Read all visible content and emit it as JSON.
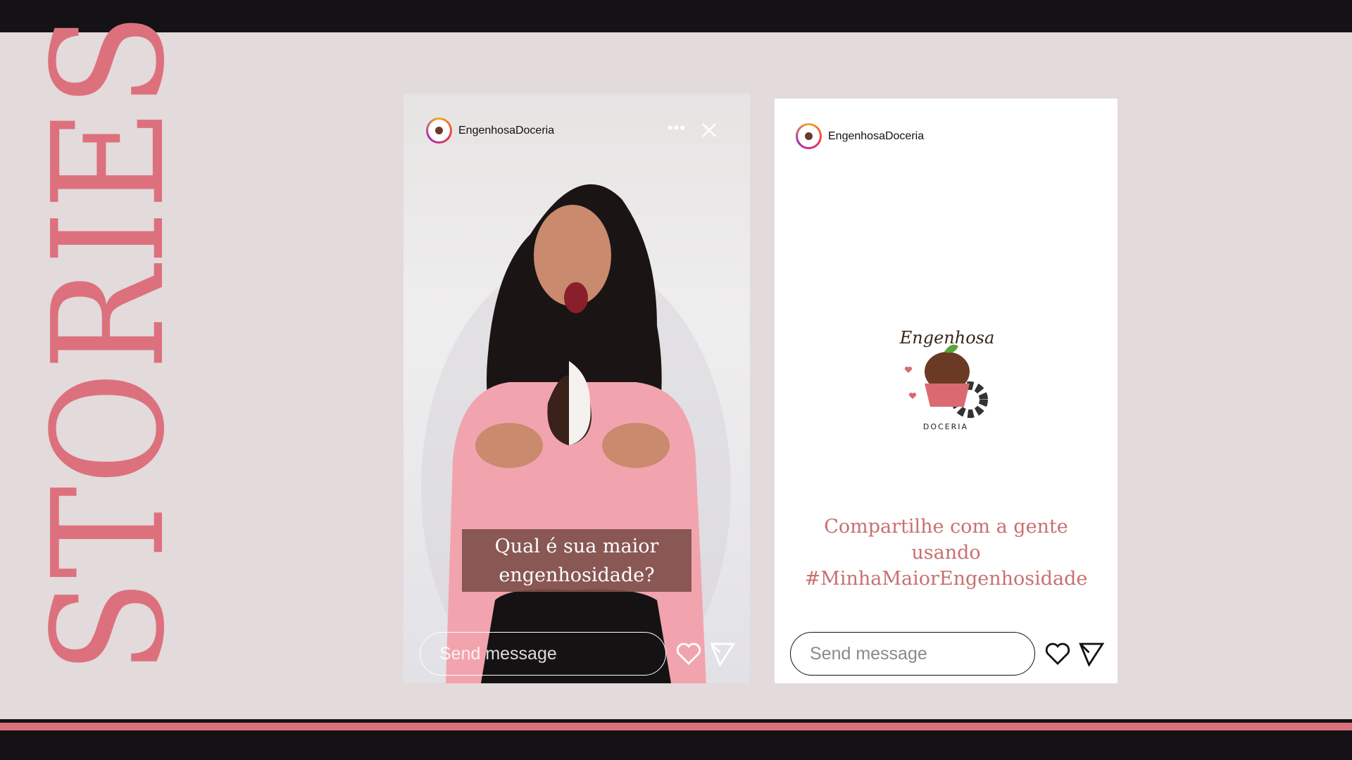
{
  "title": "STORIES",
  "colors": {
    "accent": "#dc717d",
    "dark": "#141215",
    "background": "#e3dadb"
  },
  "story1": {
    "username": "EngenhosaDoceria",
    "caption_line1": "Qual é sua maior",
    "caption_line2": "engenhosidade?",
    "message_placeholder": "Send message",
    "icons": [
      "more-icon",
      "close-icon",
      "heart-icon",
      "send-icon"
    ]
  },
  "story2": {
    "username": "EngenhosaDoceria",
    "logo_text_top": "Engenhosa",
    "logo_text_bottom": "DOCERIA",
    "share_line1": "Compartilhe com a gente",
    "share_line2": "usando",
    "share_line3": "#MinhaMaiorEngenhosidade",
    "message_placeholder": "Send message",
    "icons": [
      "heart-icon",
      "send-icon"
    ]
  }
}
